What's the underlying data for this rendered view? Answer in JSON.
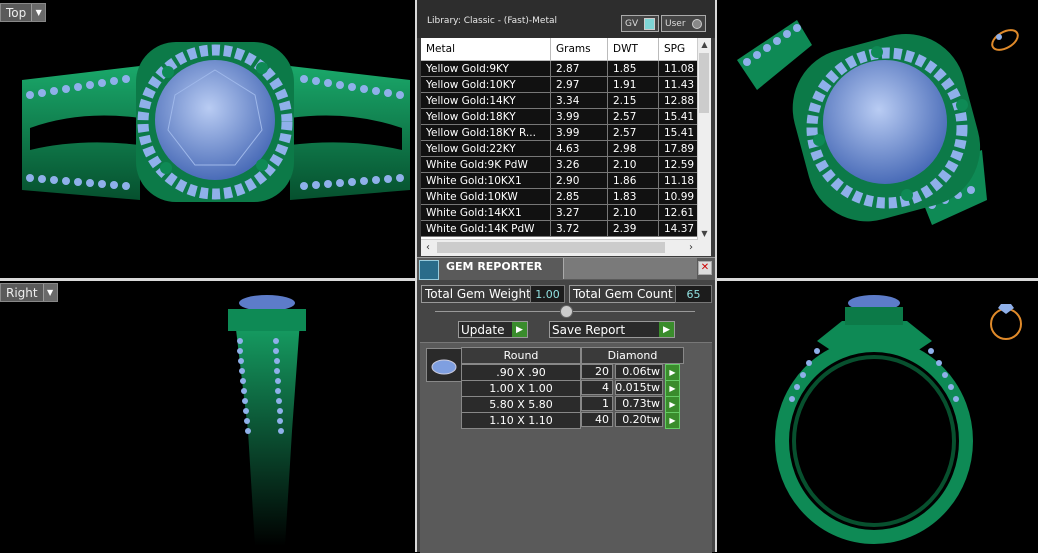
{
  "viewports": {
    "top": {
      "label": "Top"
    },
    "right": {
      "label": "Right"
    }
  },
  "library": {
    "title": "Library: Classic - (Fast)-Metal",
    "gv_label": "GV",
    "user_label": "User",
    "columns": [
      "Metal",
      "Grams",
      "DWT",
      "SPG"
    ],
    "rows": [
      [
        "Yellow Gold:9KY",
        "2.87",
        "1.85",
        "11.08"
      ],
      [
        "Yellow Gold:10KY",
        "2.97",
        "1.91",
        "11.43"
      ],
      [
        "Yellow Gold:14KY",
        "3.34",
        "2.15",
        "12.88"
      ],
      [
        "Yellow Gold:18KY",
        "3.99",
        "2.57",
        "15.41"
      ],
      [
        "Yellow Gold:18KY R...",
        "3.99",
        "2.57",
        "15.41"
      ],
      [
        "Yellow Gold:22KY",
        "4.63",
        "2.98",
        "17.89"
      ],
      [
        "White Gold:9K PdW",
        "3.26",
        "2.10",
        "12.59"
      ],
      [
        "White Gold:10KX1",
        "2.90",
        "1.86",
        "11.18"
      ],
      [
        "White Gold:10KW",
        "2.85",
        "1.83",
        "10.99"
      ],
      [
        "White Gold:14KX1",
        "3.27",
        "2.10",
        "12.61"
      ],
      [
        "White Gold:14K PdW",
        "3.72",
        "2.39",
        "14.37"
      ]
    ]
  },
  "gem_reporter": {
    "title": "GEM REPORTER",
    "total_weight_label": "Total Gem Weight",
    "total_weight": "1.00",
    "total_count_label": "Total Gem Count",
    "total_count": "65",
    "update_label": "Update",
    "save_label": "Save Report",
    "shape_header": "Round",
    "material_header": "Diamond",
    "stones": [
      {
        "size": ".90 X .90",
        "count": "20",
        "tw": "0.06tw"
      },
      {
        "size": "1.00 X 1.00",
        "count": "4",
        "tw": "0.015tw"
      },
      {
        "size": "5.80 X 5.80",
        "count": "1",
        "tw": "0.73tw"
      },
      {
        "size": "1.10 X 1.10",
        "count": "40",
        "tw": "0.20tw"
      }
    ]
  },
  "colors": {
    "metal": "#0e8a55",
    "stone": "#7f9fe0",
    "accent_go": "#3a8c2c"
  }
}
